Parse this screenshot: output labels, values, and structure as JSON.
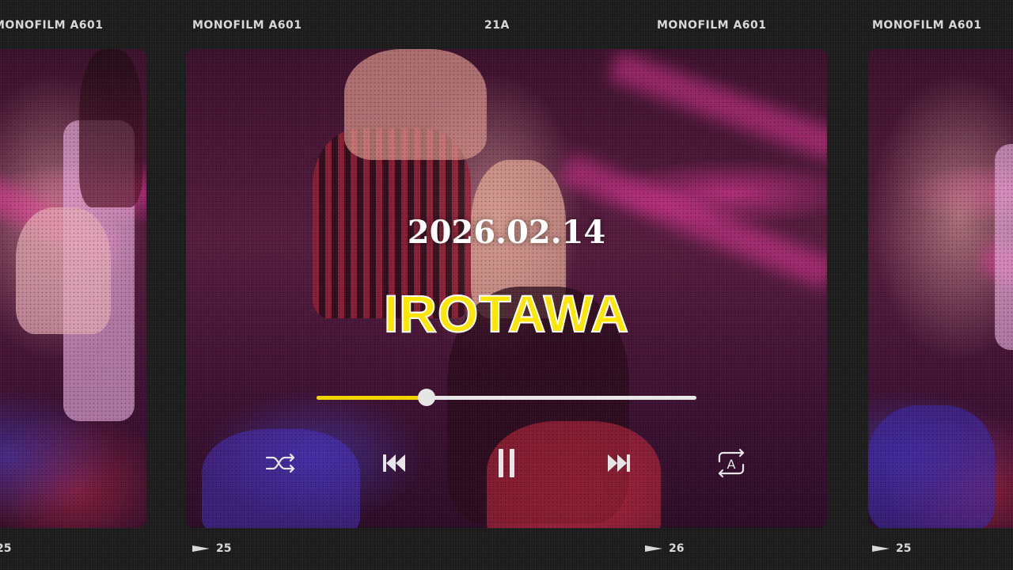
{
  "film_strip": {
    "top_labels": [
      "MONOFILM A601",
      "MONOFILM A601",
      "21A",
      "MONOFILM A601",
      "MONOFILM A601"
    ],
    "bottom_numbers": [
      "25",
      "25",
      "26",
      "25"
    ]
  },
  "player": {
    "date": "2026.02.14",
    "title": "IROTAWA",
    "progress": 0.29,
    "accent_color": "#f2d400",
    "track_color": "#e8e8e8"
  },
  "controls": {
    "shuffle_icon": "shuffle-icon",
    "previous_icon": "skip-previous-icon",
    "pause_icon": "pause-icon",
    "next_icon": "skip-next-icon",
    "repeat_icon": "repeat-a-icon",
    "repeat_letter": "A"
  }
}
